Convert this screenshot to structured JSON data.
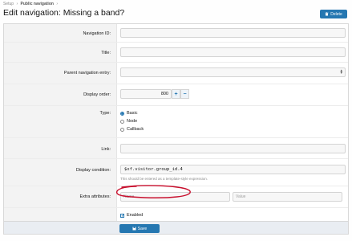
{
  "breadcrumb": {
    "items": [
      "Setup",
      "Public navigation"
    ],
    "separator": "›"
  },
  "page": {
    "title": "Edit navigation: Missing a band?"
  },
  "header": {
    "delete_label": "Delete"
  },
  "form": {
    "navigation_id": {
      "label": "Navigation ID:",
      "value": ""
    },
    "title": {
      "label": "Title:",
      "value": ""
    },
    "parent": {
      "label": "Parent navigation entry:",
      "value": ""
    },
    "display_order": {
      "label": "Display order:",
      "value": "800",
      "plus": "+",
      "minus": "−"
    },
    "type": {
      "label": "Type:",
      "options": [
        {
          "label": "Basic",
          "checked": true
        },
        {
          "label": "Node",
          "checked": false
        },
        {
          "label": "Callback",
          "checked": false
        }
      ]
    },
    "link": {
      "label": "Link:",
      "value": ""
    },
    "display_condition": {
      "label": "Display condition:",
      "value": "$xf.visitor.group_id.4",
      "hint": "This should be entered as a template-style expression."
    },
    "extra_attributes": {
      "label": "Extra attributes:",
      "name_placeholder": "Name",
      "value_placeholder": "Value"
    },
    "enabled": {
      "label": "Enabled",
      "checked": true
    }
  },
  "footer": {
    "save_label": "Save"
  },
  "colors": {
    "accent": "#2577b1",
    "annotation": "#c8102e"
  }
}
